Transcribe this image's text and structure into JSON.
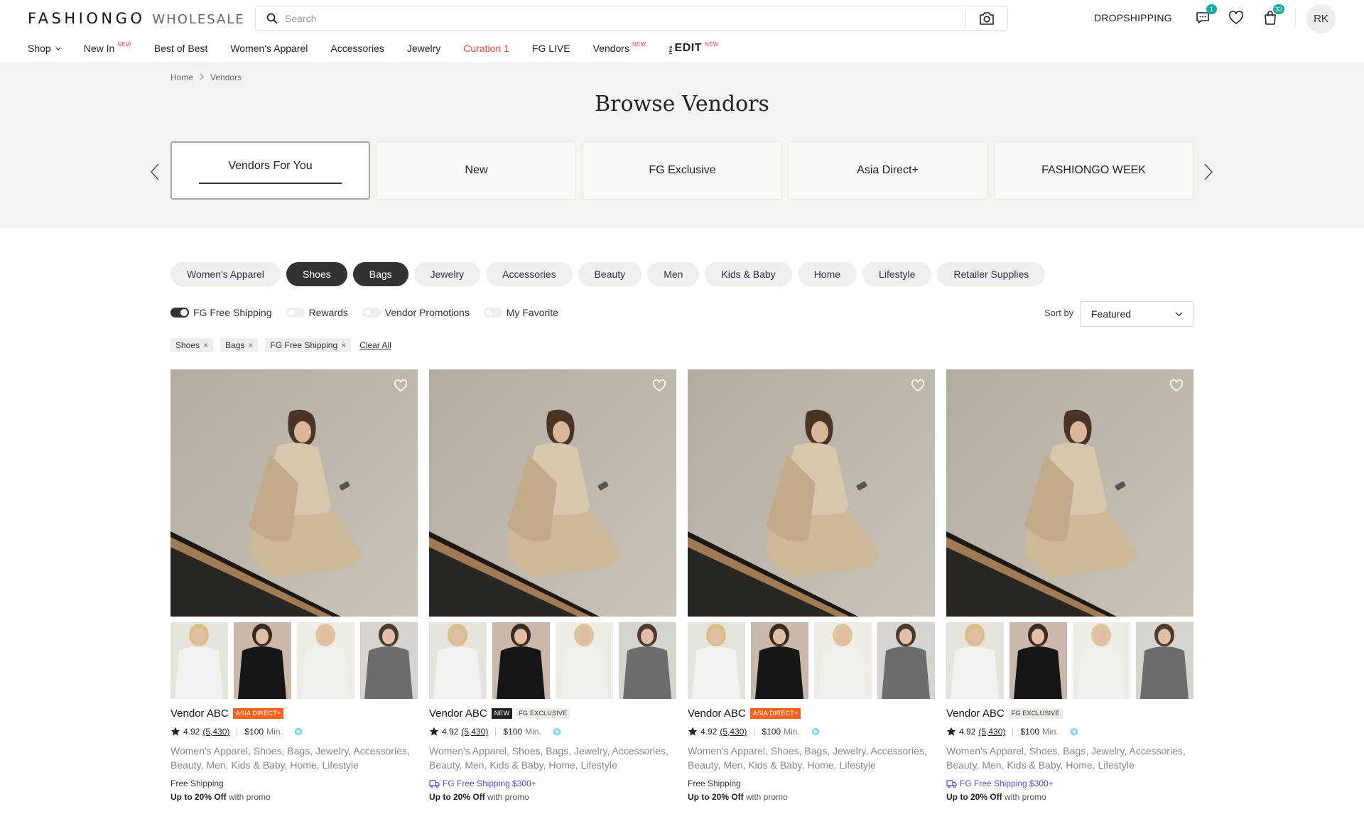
{
  "header": {
    "brand": "FASHIONGO",
    "brand_sub": "WHOLESALE",
    "search_placeholder": "Search",
    "dropshipping": "DROPSHIPPING",
    "messages_badge": "1",
    "cart_badge": "32",
    "avatar_initials": "RK"
  },
  "nav": {
    "items": [
      {
        "label": "Shop",
        "sup": ""
      },
      {
        "label": "New In",
        "sup": "NEW"
      },
      {
        "label": "Best of Best",
        "sup": ""
      },
      {
        "label": "Women's Apparel",
        "sup": ""
      },
      {
        "label": "Accessories",
        "sup": ""
      },
      {
        "label": "Jewelry",
        "sup": ""
      },
      {
        "label": "Curation 1",
        "sup": ""
      },
      {
        "label": "FG LIVE",
        "sup": ""
      },
      {
        "label": "Vendors",
        "sup": "NEW"
      }
    ],
    "edit": {
      "the": "THE",
      "label": "EDIT",
      "sup": "NEW"
    }
  },
  "hero": {
    "breadcrumbs": [
      "Home",
      "Vendors"
    ],
    "title": "Browse Vendors",
    "tabs": [
      "Vendors For You",
      "New",
      "FG Exclusive",
      "Asia Direct+",
      "FASHIONGO WEEK"
    ]
  },
  "categories": [
    "Women's Apparel",
    "Shoes",
    "Bags",
    "Jewelry",
    "Accessories",
    "Beauty",
    "Men",
    "Kids & Baby",
    "Home",
    "Lifestyle",
    "Retailer Supplies"
  ],
  "toggles": [
    {
      "label": "FG Free Shipping",
      "on": true
    },
    {
      "label": "Rewards",
      "on": false
    },
    {
      "label": "Vendor Promotions",
      "on": false
    },
    {
      "label": "My Favorite",
      "on": false
    }
  ],
  "sort": {
    "label": "Sort by",
    "value": "Featured"
  },
  "applied_filters": [
    "Shoes",
    "Bags",
    "FG Free Shipping"
  ],
  "clear_all": "Clear All",
  "vendors": [
    {
      "name": "Vendor ABC",
      "tags": [
        {
          "label": "ASIA DIRECT+",
          "kind": "asia"
        }
      ],
      "rating": "4.92",
      "reviews": "(5,430)",
      "min": "$100",
      "min_label": "Min.",
      "categories": "Women's Apparel, Shoes, Bags, Jewelry, Accessories, Beauty, Men, Kids & Baby, Home, Lifestyle",
      "shipping": "Free Shipping",
      "shipping_fg": false,
      "promo_bold": "Up to 20% Off",
      "promo_rest": " with promo"
    },
    {
      "name": "Vendor ABC",
      "tags": [
        {
          "label": "NEW",
          "kind": "new"
        },
        {
          "label": "FG EXCLUSIVE",
          "kind": "fgx"
        }
      ],
      "rating": "4.92",
      "reviews": "(5,430)",
      "min": "$100",
      "min_label": "Min.",
      "categories": "Women's Apparel, Shoes, Bags, Jewelry, Accessories, Beauty, Men, Kids & Baby, Home, Lifestyle",
      "shipping": "FG Free Shipping $300+",
      "shipping_fg": true,
      "promo_bold": "Up to 20% Off",
      "promo_rest": " with promo"
    },
    {
      "name": "Vendor ABC",
      "tags": [
        {
          "label": "ASIA DIRECT+",
          "kind": "asia"
        }
      ],
      "rating": "4.92",
      "reviews": "(5,430)",
      "min": "$100",
      "min_label": "Min.",
      "categories": "Women's Apparel, Shoes, Bags, Jewelry, Accessories, Beauty, Men, Kids & Baby, Home, Lifestyle",
      "shipping": "Free Shipping",
      "shipping_fg": false,
      "promo_bold": "Up to 20% Off",
      "promo_rest": " with promo"
    },
    {
      "name": "Vendor ABC",
      "tags": [
        {
          "label": "FG EXCLUSIVE",
          "kind": "fgx"
        }
      ],
      "rating": "4.92",
      "reviews": "(5,430)",
      "min": "$100",
      "min_label": "Min.",
      "categories": "Women's Apparel, Shoes, Bags, Jewelry, Accessories, Beauty, Men, Kids & Baby, Home, Lifestyle",
      "shipping": "FG Free Shipping $300+",
      "shipping_fg": true,
      "promo_bold": "Up to 20% Off",
      "promo_rest": " with promo"
    }
  ],
  "colors": {
    "accent_red": "#d9433c",
    "badge_teal": "#19a9a2",
    "asia_orange": "#f4631e",
    "fg_purple": "#5b46c9"
  }
}
